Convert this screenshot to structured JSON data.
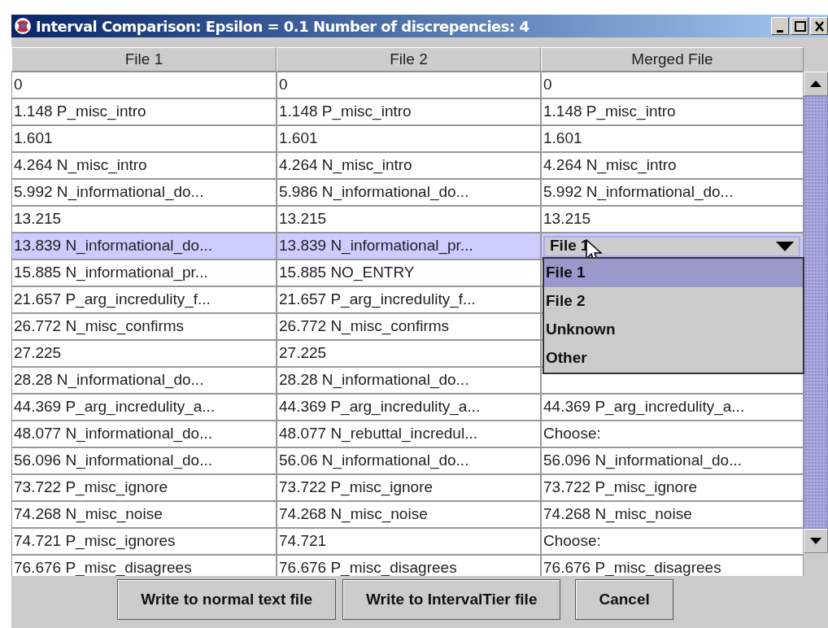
{
  "window": {
    "title": "Interval Comparison: Epsilon = 0.1 Number of discrepencies: 4"
  },
  "table": {
    "columns": [
      "File 1",
      "File 2",
      "Merged File"
    ],
    "rows": [
      {
        "file1": "0",
        "file2": "0",
        "merged": "0",
        "selected": false
      },
      {
        "file1": "1.148 P_misc_intro",
        "file2": "1.148 P_misc_intro",
        "merged": "1.148 P_misc_intro",
        "selected": false
      },
      {
        "file1": "1.601",
        "file2": "1.601",
        "merged": "1.601",
        "selected": false
      },
      {
        "file1": "4.264 N_misc_intro",
        "file2": "4.264 N_misc_intro",
        "merged": "4.264 N_misc_intro",
        "selected": false
      },
      {
        "file1": "5.992 N_informational_do...",
        "file2": "5.986 N_informational_do...",
        "merged": "5.992 N_informational_do...",
        "selected": false
      },
      {
        "file1": "13.215",
        "file2": "13.215",
        "merged": "13.215",
        "selected": false
      },
      {
        "file1": "13.839 N_informational_do...",
        "file2": "13.839 N_informational_pr...",
        "selected": true,
        "editor": {
          "value": "File 1",
          "expanded": true,
          "options": [
            {
              "label": "File 1",
              "selected": true
            },
            {
              "label": "File 2",
              "selected": false
            },
            {
              "label": "Unknown",
              "selected": false
            },
            {
              "label": "Other",
              "selected": false
            }
          ]
        }
      },
      {
        "file1": "15.885 N_informational_pr...",
        "file2": "15.885 NO_ENTRY",
        "selected": false
      },
      {
        "file1": "21.657 P_arg_incredulity_f...",
        "file2": "21.657 P_arg_incredulity_f...",
        "selected": false
      },
      {
        "file1": "26.772 N_misc_confirms",
        "file2": "26.772 N_misc_confirms",
        "selected": false
      },
      {
        "file1": "27.225",
        "file2": "27.225",
        "selected": false
      },
      {
        "file1": "28.28 N_informational_do...",
        "file2": "28.28 N_informational_do...",
        "selected": false
      },
      {
        "file1": "44.369 P_arg_incredulity_a...",
        "file2": "44.369 P_arg_incredulity_a...",
        "merged": "44.369 P_arg_incredulity_a...",
        "selected": false
      },
      {
        "file1": "48.077 N_informational_do...",
        "file2": "48.077 N_rebuttal_incredul...",
        "merged": "Choose:",
        "selected": false
      },
      {
        "file1": "56.096 N_informational_do...",
        "file2": "56.06 N_informational_do...",
        "merged": "56.096 N_informational_do...",
        "selected": false
      },
      {
        "file1": "73.722 P_misc_ignore",
        "file2": "73.722 P_misc_ignore",
        "merged": "73.722 P_misc_ignore",
        "selected": false
      },
      {
        "file1": "74.268 N_misc_noise",
        "file2": "74.268 N_misc_noise",
        "merged": "74.268 N_misc_noise",
        "selected": false
      },
      {
        "file1": "74.721 P_misc_ignores",
        "file2": "74.721",
        "merged": "Choose:",
        "selected": false
      },
      {
        "file1": "76.676 P_misc_disagrees",
        "file2": "76.676 P_misc_disagrees",
        "merged": "76.676 P_misc_disagrees",
        "selected": false
      }
    ]
  },
  "buttons": [
    "Write to normal text file",
    "Write to IntervalTier file",
    "Cancel"
  ]
}
